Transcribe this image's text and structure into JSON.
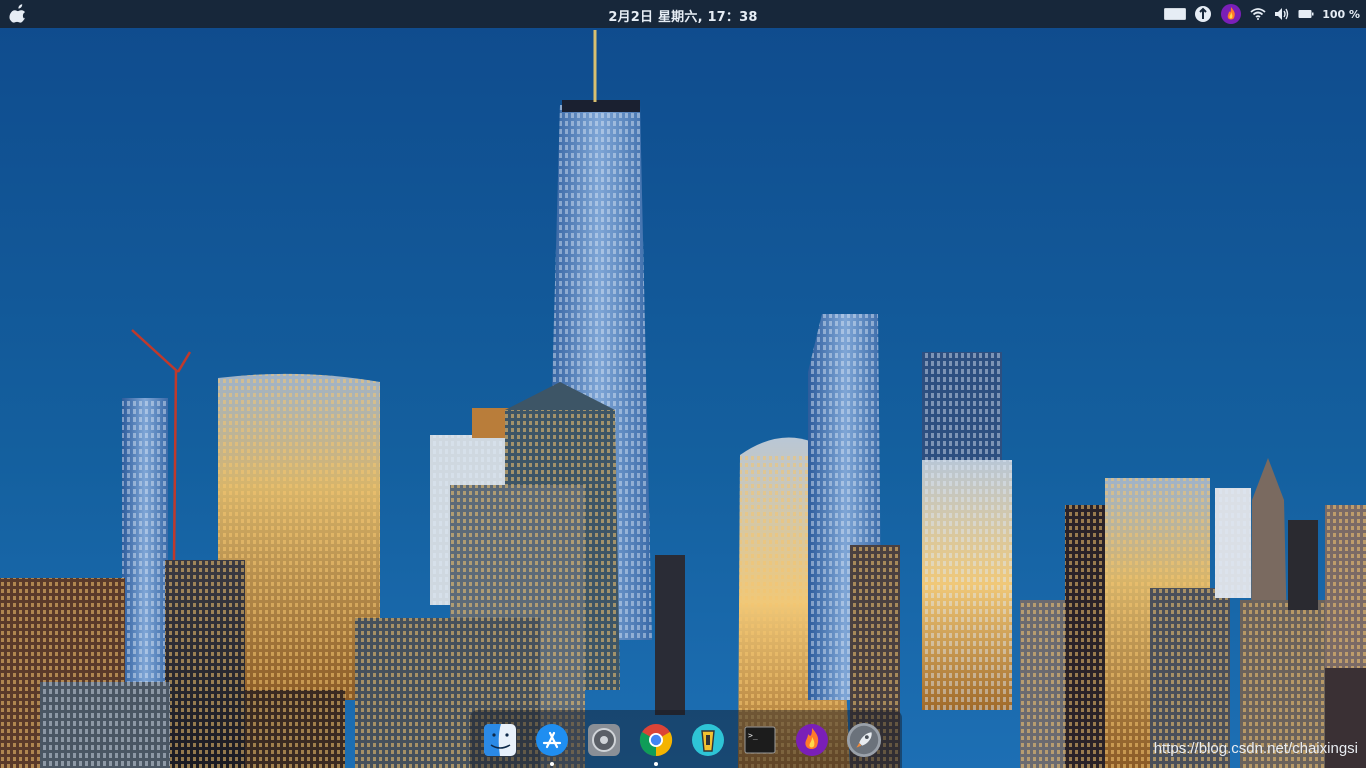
{
  "topbar": {
    "clock": "2月2日 星期六, 17：38",
    "battery": "100 %",
    "apple_icon": "apple-logo-icon",
    "tray_icons": [
      "keyboard-icon",
      "upload-icon",
      "flame-app-icon",
      "wifi-icon",
      "volume-icon",
      "battery-icon"
    ]
  },
  "dock": {
    "items": [
      {
        "name": "finder",
        "icon": "finder-icon",
        "running": false
      },
      {
        "name": "app-store",
        "icon": "app-store-icon",
        "running": true
      },
      {
        "name": "system-settings",
        "icon": "settings-icon",
        "running": false
      },
      {
        "name": "chrome",
        "icon": "chrome-icon",
        "running": true
      },
      {
        "name": "robot-app",
        "icon": "robot-icon",
        "running": false
      },
      {
        "name": "terminal",
        "icon": "terminal-icon",
        "running": false
      },
      {
        "name": "flame-app",
        "icon": "flame-icon",
        "running": false
      },
      {
        "name": "launchpad",
        "icon": "rocket-icon",
        "running": false
      }
    ],
    "terminal_prompt": ">_"
  },
  "watermark": "https://blog.csdn.net/chaixingsi",
  "colors": {
    "topbar": "#17273a",
    "sky_top": "#0f4a8c",
    "sky_bottom": "#1c6cb3"
  }
}
